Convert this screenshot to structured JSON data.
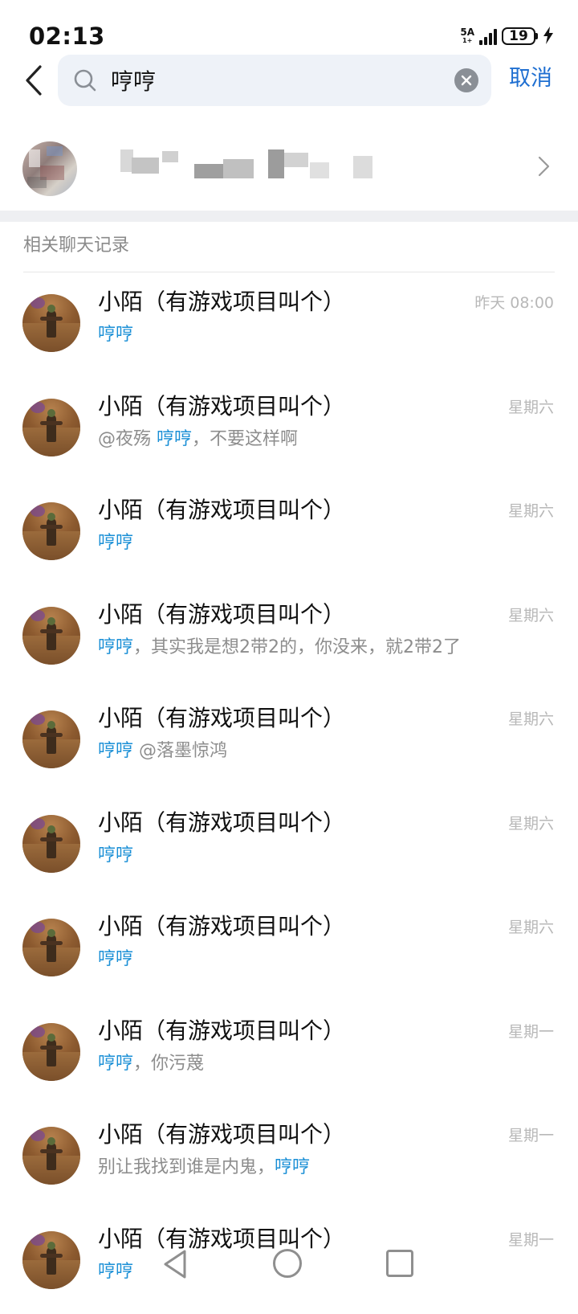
{
  "status_bar": {
    "time": "02:13",
    "network_type": "5A",
    "network_sub": "1+",
    "battery_level": "19",
    "charging_icon": "bolt-icon"
  },
  "search": {
    "query": "哼哼",
    "cancel_label": "取消",
    "search_icon": "search-icon",
    "clear_icon": "clear-icon",
    "back_icon": "back-arrow-icon"
  },
  "section": {
    "title": "相关聊天记录"
  },
  "colors": {
    "accent": "#1f6fd1",
    "highlight": "#1a8fd6",
    "secondary_text": "#8d8d8d",
    "time_text": "#b8b8b8"
  },
  "results": [
    {
      "title": "小陌（有游戏项目叫个）",
      "time": "昨天 08:00",
      "snippet_before": "",
      "snippet_highlight": "哼哼",
      "snippet_after": ""
    },
    {
      "title": "小陌（有游戏项目叫个）",
      "time": "星期六",
      "snippet_before": "@夜殇  ",
      "snippet_highlight": "哼哼",
      "snippet_after": "，不要这样啊"
    },
    {
      "title": "小陌（有游戏项目叫个）",
      "time": "星期六",
      "snippet_before": "",
      "snippet_highlight": "哼哼",
      "snippet_after": ""
    },
    {
      "title": "小陌（有游戏项目叫个）",
      "time": "星期六",
      "snippet_before": "",
      "snippet_highlight": "哼哼",
      "snippet_after": "，其实我是想2带2的，你没来，就2带2了"
    },
    {
      "title": "小陌（有游戏项目叫个）",
      "time": "星期六",
      "snippet_before": "",
      "snippet_highlight": "哼哼",
      "snippet_after": " @落墨惊鸿"
    },
    {
      "title": "小陌（有游戏项目叫个）",
      "time": "星期六",
      "snippet_before": "",
      "snippet_highlight": "哼哼",
      "snippet_after": ""
    },
    {
      "title": "小陌（有游戏项目叫个）",
      "time": "星期六",
      "snippet_before": "",
      "snippet_highlight": "哼哼",
      "snippet_after": ""
    },
    {
      "title": "小陌（有游戏项目叫个）",
      "time": "星期一",
      "snippet_before": "",
      "snippet_highlight": "哼哼",
      "snippet_after": "，你污蔑"
    },
    {
      "title": "小陌（有游戏项目叫个）",
      "time": "星期一",
      "snippet_before": "别让我找到谁是内鬼，",
      "snippet_highlight": "哼哼",
      "snippet_after": ""
    },
    {
      "title": "小陌（有游戏项目叫个）",
      "time": "星期一",
      "snippet_before": "",
      "snippet_highlight": "哼哼",
      "snippet_after": ""
    }
  ],
  "nav": {
    "back_icon": "nav-back-icon",
    "home_icon": "nav-home-icon",
    "recent_icon": "nav-recent-icon"
  }
}
